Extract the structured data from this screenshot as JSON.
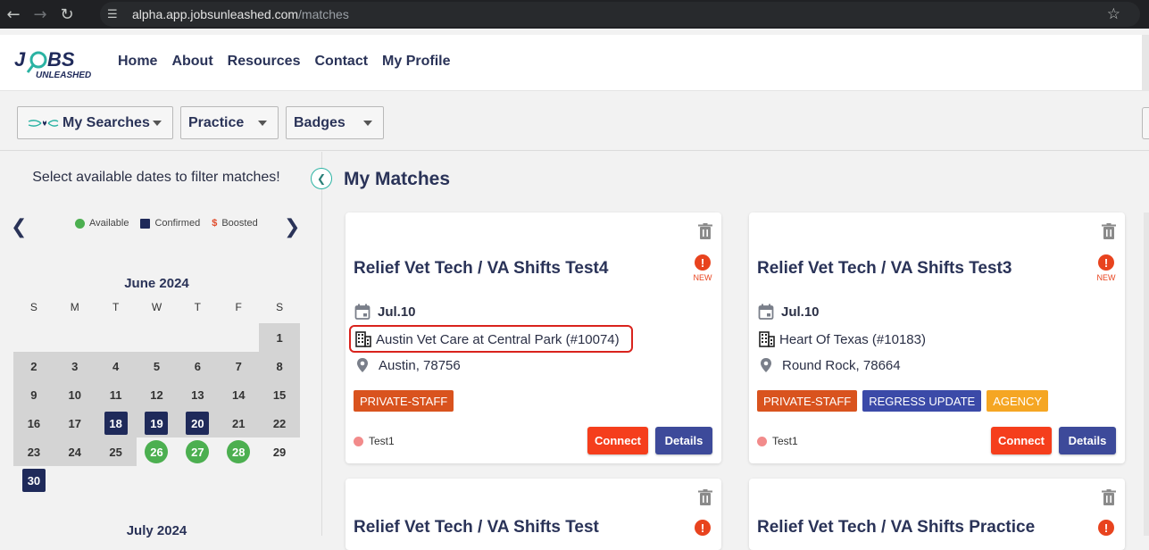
{
  "browser": {
    "url_host": "alpha.app.jobsunleashed.com",
    "url_path": "/matches"
  },
  "nav": {
    "logo_top": "J BS",
    "logo_bottom": "UNLEASHED",
    "links": [
      "Home",
      "About",
      "Resources",
      "Contact",
      "My Profile"
    ]
  },
  "filters": {
    "my_searches": "My Searches",
    "practice": "Practice",
    "badges": "Badges"
  },
  "sidebar": {
    "title": "Select available dates to filter matches!",
    "legend": {
      "available": "Available",
      "confirmed": "Confirmed",
      "boosted_symbol": "$",
      "boosted": "Boosted"
    },
    "weekdays": [
      "S",
      "M",
      "T",
      "W",
      "T",
      "F",
      "S"
    ],
    "june": {
      "title": "June 2024",
      "days": [
        {
          "d": "",
          "s": "blank"
        },
        {
          "d": "",
          "s": "blank"
        },
        {
          "d": "",
          "s": "blank"
        },
        {
          "d": "",
          "s": "blank"
        },
        {
          "d": "",
          "s": "blank"
        },
        {
          "d": "",
          "s": "blank"
        },
        {
          "d": "1",
          "s": "gray"
        },
        {
          "d": "2",
          "s": "gray"
        },
        {
          "d": "3",
          "s": "gray"
        },
        {
          "d": "4",
          "s": "gray"
        },
        {
          "d": "5",
          "s": "gray"
        },
        {
          "d": "6",
          "s": "gray"
        },
        {
          "d": "7",
          "s": "gray"
        },
        {
          "d": "8",
          "s": "gray"
        },
        {
          "d": "9",
          "s": "gray"
        },
        {
          "d": "10",
          "s": "gray"
        },
        {
          "d": "11",
          "s": "gray"
        },
        {
          "d": "12",
          "s": "gray"
        },
        {
          "d": "13",
          "s": "gray"
        },
        {
          "d": "14",
          "s": "gray"
        },
        {
          "d": "15",
          "s": "gray"
        },
        {
          "d": "16",
          "s": "gray"
        },
        {
          "d": "17",
          "s": "gray"
        },
        {
          "d": "18",
          "s": "confirmed"
        },
        {
          "d": "19",
          "s": "confirmed"
        },
        {
          "d": "20",
          "s": "confirmed"
        },
        {
          "d": "21",
          "s": "gray"
        },
        {
          "d": "22",
          "s": "gray"
        },
        {
          "d": "23",
          "s": "gray"
        },
        {
          "d": "24",
          "s": "gray"
        },
        {
          "d": "25",
          "s": "gray"
        },
        {
          "d": "26",
          "s": "available"
        },
        {
          "d": "27",
          "s": "available"
        },
        {
          "d": "28",
          "s": "available"
        },
        {
          "d": "29",
          "s": "normal"
        },
        {
          "d": "30",
          "s": "confirmed"
        }
      ]
    },
    "july_title": "July 2024"
  },
  "main": {
    "title": "My Matches",
    "cards": [
      {
        "title": "Relief Vet Tech / VA Shifts Test4",
        "new_label": "NEW",
        "date": "Jul.10",
        "org": "Austin Vet Care at Central Park (#10074)",
        "location": "Austin, 78756",
        "tags": [
          {
            "label": "PRIVATE-STAFF",
            "kind": "ps"
          }
        ],
        "test_label": "Test1",
        "connect": "Connect",
        "details": "Details",
        "highlighted": true
      },
      {
        "title": "Relief Vet Tech / VA Shifts Test3",
        "new_label": "NEW",
        "date": "Jul.10",
        "org": "Heart Of Texas (#10183)",
        "location": "Round Rock, 78664",
        "tags": [
          {
            "label": "PRIVATE-STAFF",
            "kind": "ps"
          },
          {
            "label": "REGRESS UPDATE",
            "kind": "ru"
          },
          {
            "label": "AGENCY",
            "kind": "ag"
          }
        ],
        "test_label": "Test1",
        "connect": "Connect",
        "details": "Details",
        "highlighted": false
      },
      {
        "title": "Relief Vet Tech / VA Shifts Test"
      },
      {
        "title": "Relief Vet Tech / VA Shifts Practice"
      }
    ]
  },
  "colors": {
    "brand_navy": "#2a3358",
    "connect": "#f53e1c",
    "details": "#3d4a9a",
    "available": "#4caf50",
    "confirmed": "#1f2a5a",
    "highlight": "#d9231d"
  }
}
